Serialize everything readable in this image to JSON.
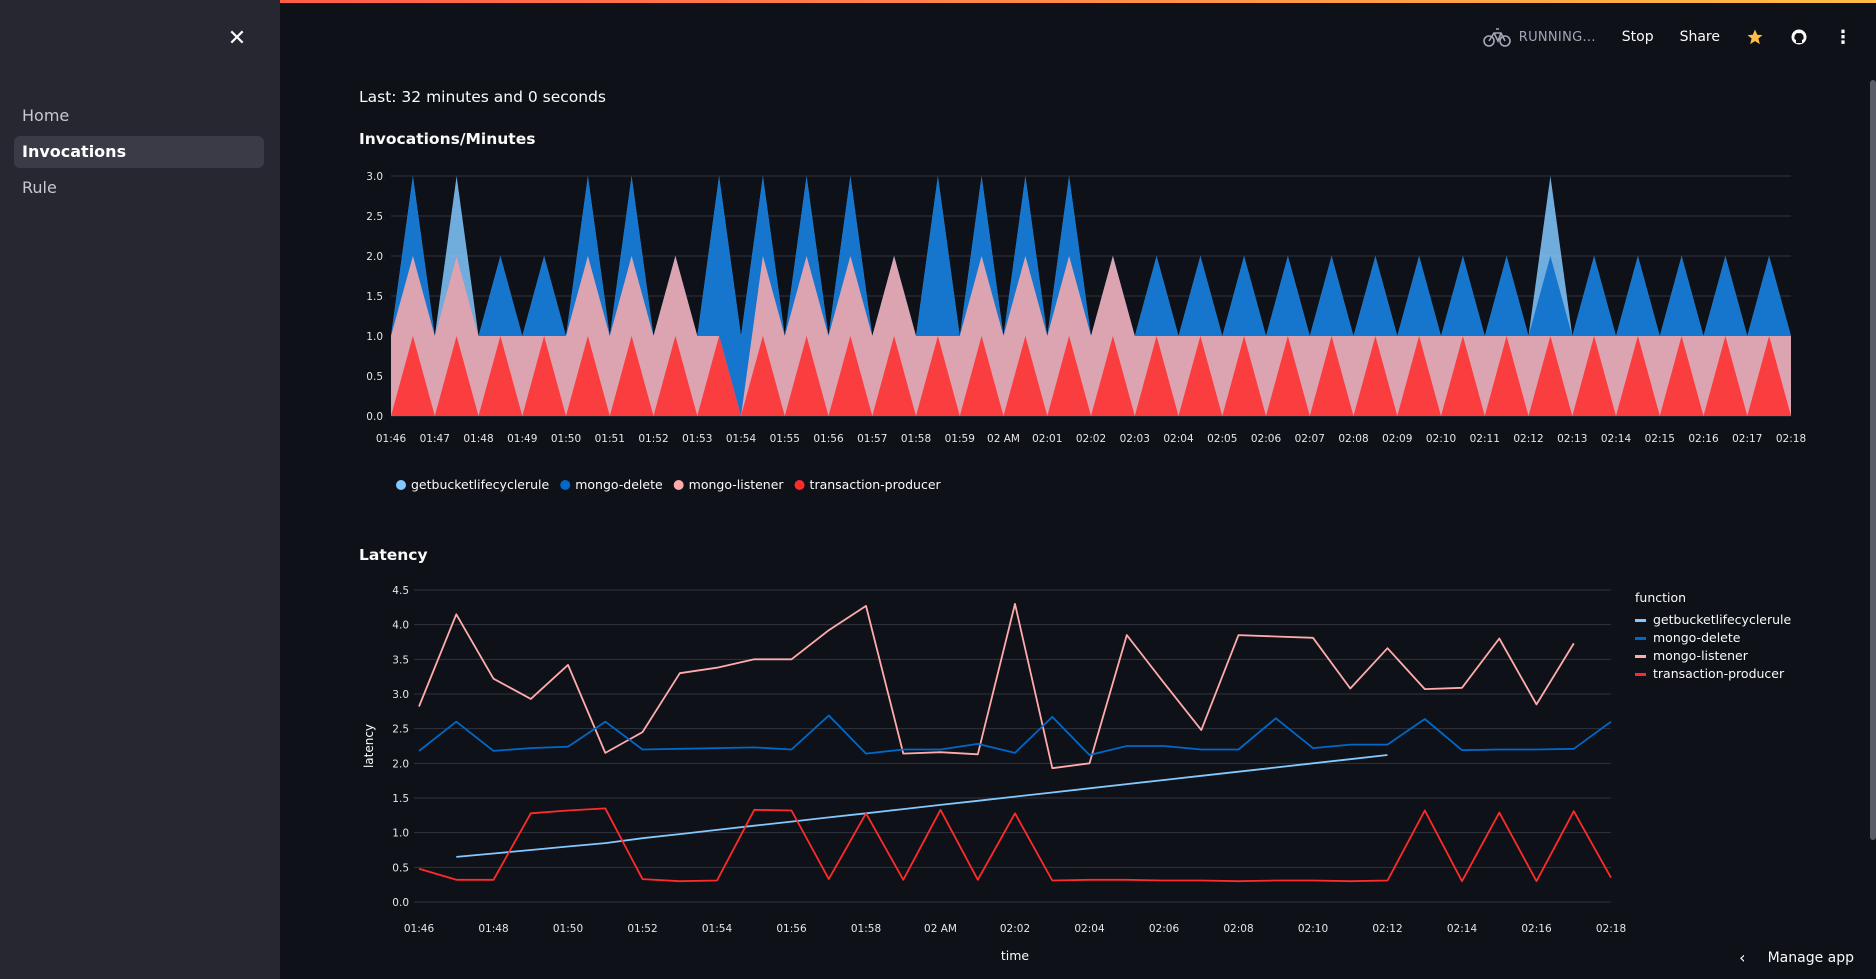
{
  "sidebar": {
    "items": [
      {
        "label": "Home",
        "active": false
      },
      {
        "label": "Invocations",
        "active": true
      },
      {
        "label": "Rule",
        "active": false
      }
    ]
  },
  "header": {
    "status": "RUNNING...",
    "stop": "Stop",
    "share": "Share",
    "icons": [
      "running-bike-icon",
      "star-icon",
      "github-icon",
      "more-vertical-icon"
    ]
  },
  "main": {
    "last_text": "Last: 32 minutes and 0 seconds",
    "invocations_title": "Invocations/Minutes",
    "latency_title": "Latency"
  },
  "footer": {
    "manage_app": "Manage app"
  },
  "colors": {
    "getbucketlifecyclerule": "#83c9ff",
    "mongo-delete": "#0068c9",
    "mongo-listener": "#ffabab",
    "transaction-producer": "#ff2b2b"
  },
  "chart_data": [
    {
      "type": "area",
      "stacked": true,
      "title": "Invocations/Minutes",
      "ylim": [
        0,
        3
      ],
      "yticks": [
        "0.0",
        "0.5",
        "1.0",
        "1.5",
        "2.0",
        "2.5",
        "3.0"
      ],
      "x_tick_labels": [
        "01:46",
        "01:47",
        "01:48",
        "01:49",
        "01:50",
        "01:51",
        "01:52",
        "01:53",
        "01:54",
        "01:55",
        "01:56",
        "01:57",
        "01:58",
        "01:59",
        "02 AM",
        "02:01",
        "02:02",
        "02:03",
        "02:04",
        "02:05",
        "02:06",
        "02:07",
        "02:08",
        "02:09",
        "02:10",
        "02:11",
        "02:12",
        "02:13",
        "02:14",
        "02:15",
        "02:16",
        "02:17",
        "02:18"
      ],
      "legend": [
        "getbucketlifecyclerule",
        "mongo-delete",
        "mongo-listener",
        "transaction-producer"
      ],
      "legend_position": "bottom",
      "series": [
        {
          "name": "transaction-producer",
          "values": [
            0,
            1,
            0,
            1,
            0,
            1,
            0,
            1,
            0,
            1,
            0,
            1,
            0,
            1,
            0,
            1,
            0,
            1,
            0,
            1,
            0,
            1,
            0,
            1,
            0,
            1,
            0,
            1,
            0,
            1,
            0,
            1,
            0,
            1,
            0,
            1,
            0,
            1,
            0,
            1,
            0,
            1,
            0,
            1,
            0,
            1,
            0,
            1,
            0,
            1,
            0,
            1,
            0,
            1,
            0,
            1,
            0,
            1,
            0,
            1,
            0,
            1,
            0,
            1,
            0
          ]
        },
        {
          "name": "mongo-listener",
          "values": [
            1,
            2,
            1,
            2,
            1,
            1,
            1,
            1,
            1,
            2,
            1,
            2,
            1,
            2,
            1,
            0,
            0,
            2,
            1,
            2,
            1,
            2,
            1,
            2,
            1,
            1,
            1,
            2,
            1,
            2,
            1,
            2,
            1,
            2,
            1,
            1,
            1,
            1,
            1,
            1,
            1,
            1,
            1,
            1,
            1,
            1,
            1,
            1,
            1,
            1,
            1,
            1,
            1,
            1,
            1,
            1,
            1,
            1,
            1,
            1,
            1,
            1,
            1,
            1,
            1
          ]
        },
        {
          "name": "mongo-delete",
          "values": [
            1,
            3,
            1,
            2,
            1,
            2,
            1,
            2,
            1,
            3,
            1,
            3,
            1,
            1,
            1,
            3,
            1,
            3,
            1,
            3,
            1,
            3,
            1,
            2,
            1,
            3,
            1,
            3,
            1,
            3,
            1,
            3,
            1,
            2,
            1,
            2,
            1,
            2,
            1,
            2,
            1,
            2,
            1,
            2,
            1,
            2,
            1,
            2,
            1,
            2,
            1,
            2,
            1,
            2,
            1,
            2,
            1,
            2,
            1,
            2,
            1,
            2,
            1,
            2,
            1
          ]
        },
        {
          "name": "getbucketlifecyclerule",
          "values": [
            0,
            3,
            0,
            3,
            0,
            2,
            0,
            0,
            0,
            0,
            0,
            0,
            0,
            0,
            0,
            0,
            0,
            0,
            0,
            0,
            0,
            0,
            0,
            0,
            0,
            0,
            0,
            0,
            0,
            0,
            0,
            0,
            0,
            0,
            0,
            0,
            0,
            0,
            0,
            0,
            0,
            0,
            0,
            0,
            0,
            0,
            0,
            0,
            0,
            0,
            0,
            0,
            0,
            3,
            0,
            2,
            0,
            0,
            0,
            0,
            0,
            0,
            0,
            0,
            0
          ]
        }
      ]
    },
    {
      "type": "line",
      "title": "Latency",
      "xlabel": "time",
      "ylabel": "latency",
      "ylim": [
        0,
        4.5
      ],
      "yticks": [
        "0.0",
        "0.5",
        "1.0",
        "1.5",
        "2.0",
        "2.5",
        "3.0",
        "3.5",
        "4.0",
        "4.5"
      ],
      "x_tick_labels": [
        "01:46",
        "01:48",
        "01:50",
        "01:52",
        "01:54",
        "01:56",
        "01:58",
        "02 AM",
        "02:02",
        "02:04",
        "02:06",
        "02:08",
        "02:10",
        "02:12",
        "02:14",
        "02:16",
        "02:18"
      ],
      "x": [
        "01:46",
        "01:47",
        "01:48",
        "01:49",
        "01:50",
        "01:51",
        "01:52",
        "01:53",
        "01:54",
        "01:55",
        "01:56",
        "01:57",
        "01:58",
        "01:59",
        "02:00",
        "02:01",
        "02:02",
        "02:03",
        "02:04",
        "02:05",
        "02:06",
        "02:07",
        "02:08",
        "02:09",
        "02:10",
        "02:11",
        "02:12",
        "02:13",
        "02:14",
        "02:15",
        "02:16",
        "02:17",
        "02:18"
      ],
      "legend_title": "function",
      "legend": [
        "getbucketlifecyclerule",
        "mongo-delete",
        "mongo-listener",
        "transaction-producer"
      ],
      "legend_position": "right",
      "series": [
        {
          "name": "mongo-listener",
          "values": [
            2.82,
            4.15,
            3.22,
            2.93,
            3.42,
            2.15,
            2.45,
            3.3,
            3.38,
            3.5,
            3.5,
            3.92,
            4.27,
            2.14,
            2.16,
            2.13,
            4.3,
            1.93,
            2.0,
            3.85,
            3.16,
            2.48,
            3.85,
            3.83,
            3.81,
            3.08,
            3.66,
            3.07,
            3.09,
            3.8,
            2.85,
            3.73,
            null
          ]
        },
        {
          "name": "mongo-delete",
          "values": [
            2.18,
            2.6,
            2.18,
            2.22,
            2.24,
            2.6,
            2.2,
            2.21,
            2.22,
            2.23,
            2.2,
            2.69,
            2.14,
            2.2,
            2.2,
            2.28,
            2.15,
            2.67,
            2.12,
            2.25,
            2.25,
            2.2,
            2.2,
            2.65,
            2.22,
            2.27,
            2.27,
            2.64,
            2.19,
            2.2,
            2.2,
            2.21,
            2.6
          ]
        },
        {
          "name": "getbucketlifecyclerule",
          "values": [
            null,
            0.65,
            0.7,
            0.75,
            0.8,
            0.85,
            0.92,
            0.98,
            1.04,
            1.1,
            1.16,
            1.22,
            1.28,
            1.34,
            1.4,
            1.46,
            1.52,
            1.58,
            1.64,
            1.7,
            1.76,
            1.82,
            1.88,
            1.94,
            2.0,
            2.06,
            2.12,
            null,
            null,
            null,
            null,
            null,
            null
          ]
        },
        {
          "name": "transaction-producer",
          "values": [
            0.48,
            0.32,
            0.32,
            1.28,
            1.32,
            1.35,
            0.33,
            0.3,
            0.31,
            1.33,
            1.32,
            0.33,
            1.28,
            0.32,
            1.33,
            0.32,
            1.28,
            0.31,
            0.32,
            0.32,
            0.31,
            0.31,
            0.3,
            0.31,
            0.31,
            0.3,
            0.31,
            1.32,
            0.3,
            1.29,
            0.3,
            1.31,
            0.35
          ]
        }
      ]
    }
  ]
}
